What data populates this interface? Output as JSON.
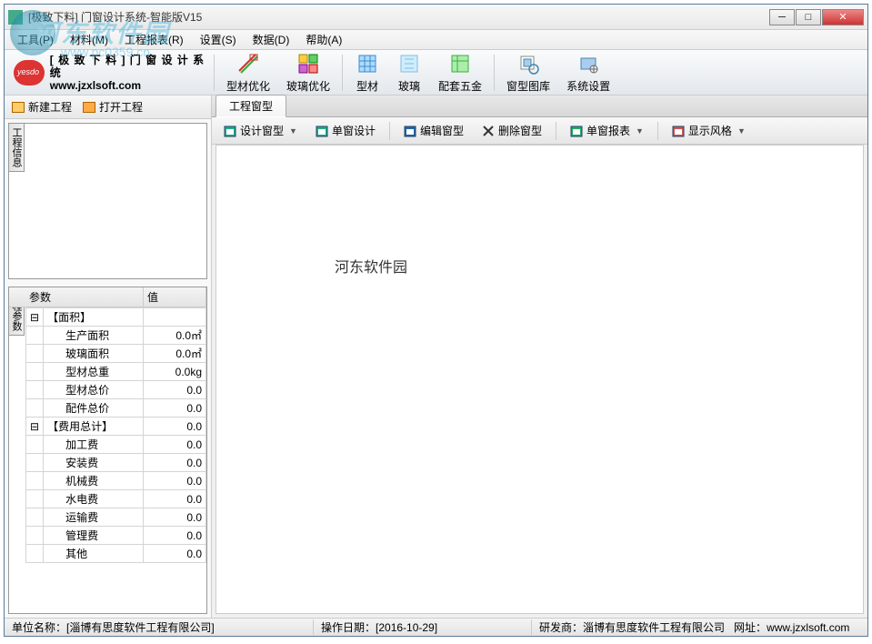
{
  "window": {
    "title": "[极致下料] 门窗设计系统-智能版V15"
  },
  "watermark": {
    "text": "河东软件园",
    "url": "www.pc0359.cn"
  },
  "menu": {
    "items": [
      "工具(P)",
      "材料(M)",
      "工程报表(R)",
      "设置(S)",
      "数据(D)",
      "帮助(A)"
    ]
  },
  "banner": {
    "line1": "[ 极 致 下 料 ] 门 窗 设 计 系 统",
    "line2": "www.jzxlsoft.com"
  },
  "main_toolbar": [
    {
      "name": "profile-optimize",
      "label": "型材优化"
    },
    {
      "name": "glass-optimize",
      "label": "玻璃优化"
    },
    {
      "name": "profile",
      "label": "型材"
    },
    {
      "name": "glass",
      "label": "玻璃"
    },
    {
      "name": "hardware",
      "label": "配套五金"
    },
    {
      "name": "window-library",
      "label": "窗型图库"
    },
    {
      "name": "system-settings",
      "label": "系统设置"
    }
  ],
  "left_toolbar": {
    "new_project": "新建工程",
    "open_project": "打开工程"
  },
  "left_vtabs": {
    "top": "工程信息",
    "bottom": "工程参数"
  },
  "param_header": {
    "col1": "参数",
    "col2": "值"
  },
  "params": [
    {
      "type": "group",
      "expand": "⊟",
      "name": "【面积】",
      "value": ""
    },
    {
      "type": "row",
      "name": "生产面积",
      "value": "0.0㎡"
    },
    {
      "type": "row",
      "name": "玻璃面积",
      "value": "0.0㎡"
    },
    {
      "type": "row",
      "name": "型材总重",
      "value": "0.0kg"
    },
    {
      "type": "row",
      "name": "型材总价",
      "value": "0.0"
    },
    {
      "type": "row",
      "name": "配件总价",
      "value": "0.0"
    },
    {
      "type": "group",
      "expand": "⊟",
      "name": "【费用总计】",
      "value": "0.0"
    },
    {
      "type": "row",
      "name": "加工费",
      "value": "0.0"
    },
    {
      "type": "row",
      "name": "安装费",
      "value": "0.0"
    },
    {
      "type": "row",
      "name": "机械费",
      "value": "0.0"
    },
    {
      "type": "row",
      "name": "水电费",
      "value": "0.0"
    },
    {
      "type": "row",
      "name": "运输费",
      "value": "0.0"
    },
    {
      "type": "row",
      "name": "管理费",
      "value": "0.0"
    },
    {
      "type": "row",
      "name": "其他",
      "value": "0.0"
    }
  ],
  "right_tab": "工程窗型",
  "right_toolbar": [
    {
      "name": "design-window",
      "label": "设计窗型",
      "dropdown": true
    },
    {
      "name": "single-design",
      "label": "单窗设计"
    },
    {
      "sep": true
    },
    {
      "name": "edit-window",
      "label": "编辑窗型"
    },
    {
      "name": "delete-window",
      "label": "删除窗型"
    },
    {
      "sep": true
    },
    {
      "name": "single-report",
      "label": "单窗报表",
      "dropdown": true
    },
    {
      "sep": true
    },
    {
      "name": "display-style",
      "label": "显示风格",
      "dropdown": true
    }
  ],
  "canvas_watermark": "河东软件园",
  "status": {
    "company_label": "单位名称：",
    "company": "[淄博有思度软件工程有限公司]",
    "date_label": "操作日期：",
    "date": "[2016-10-29]",
    "dev_label": "研发商：",
    "dev": "淄博有思度软件工程有限公司",
    "site_label": "网址：",
    "site": "www.jzxlsoft.com"
  }
}
